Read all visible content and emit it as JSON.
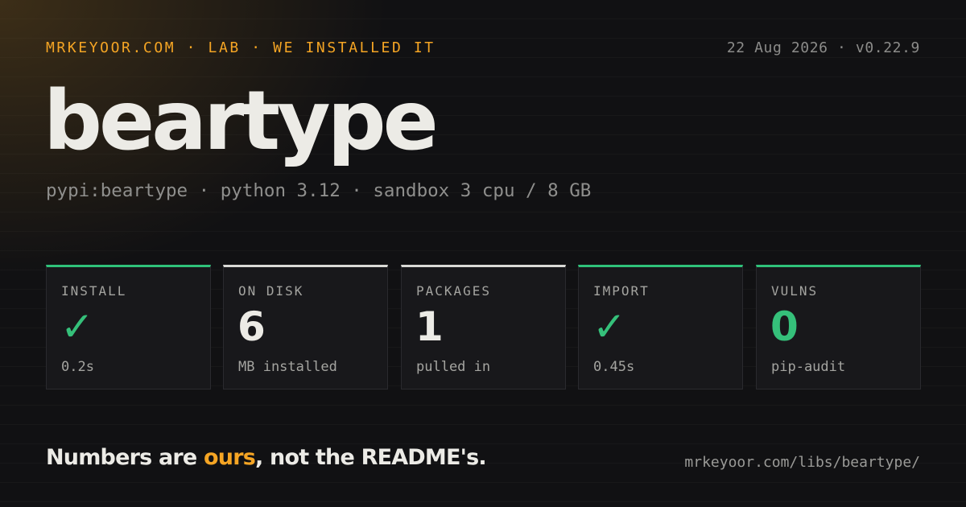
{
  "header": {
    "kicker": "MRKEYOOR.COM · LAB · WE INSTALLED IT",
    "meta": "22 Aug 2026 · v0.22.9"
  },
  "title": "beartype",
  "subtitle": "pypi:beartype · python 3.12 · sandbox 3 cpu / 8 GB",
  "cards": [
    {
      "label": "INSTALL",
      "value": "✓",
      "note": "0.2s",
      "status": "good",
      "accent_color": "#2fc27a"
    },
    {
      "label": "ON DISK",
      "value": "6",
      "note": "MB installed",
      "status": "neutral",
      "accent_color": "#dadad6"
    },
    {
      "label": "PACKAGES",
      "value": "1",
      "note": "pulled in",
      "status": "neutral",
      "accent_color": "#dadad6"
    },
    {
      "label": "IMPORT",
      "value": "✓",
      "note": "0.45s",
      "status": "good",
      "accent_color": "#2fc27a"
    },
    {
      "label": "VULNS",
      "value": "0",
      "note": "pip-audit",
      "status": "good",
      "accent_color": "#2fc27a"
    }
  ],
  "tagline": {
    "before": "Numbers are ",
    "highlight": "ours",
    "after": ", not the README's."
  },
  "footer": {
    "url": "mrkeyoor.com/libs/beartype/"
  },
  "colors": {
    "background": "#111113",
    "accent_orange": "#f5a524",
    "accent_green": "#2fc27a",
    "text_primary": "#ecebe6",
    "text_muted": "#8f8f8d"
  }
}
